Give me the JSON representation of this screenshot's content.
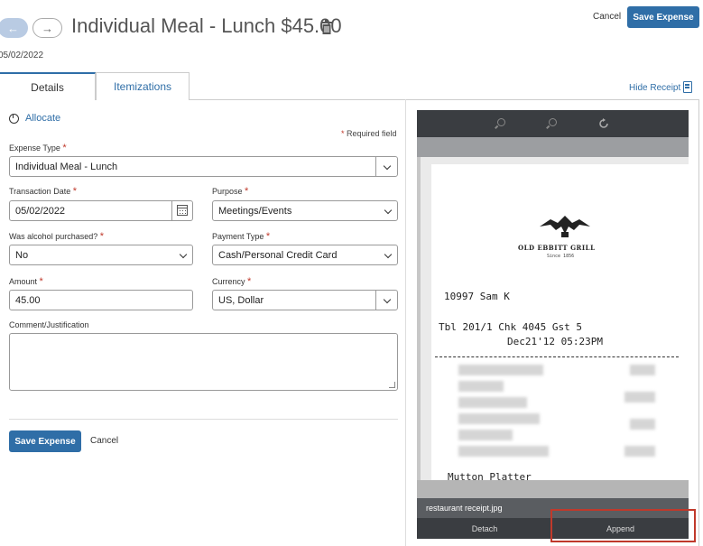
{
  "header": {
    "back_icon": "←",
    "forward_icon": "→",
    "title": "Individual Meal - Lunch $45.00",
    "date": "05/02/2022",
    "cancel_label": "Cancel",
    "save_label": "Save Expense"
  },
  "tabs": [
    {
      "label": "Details",
      "active": true
    },
    {
      "label": "Itemizations",
      "active": false
    }
  ],
  "hide_receipt_label": "Hide Receipt",
  "form": {
    "allocate_label": "Allocate",
    "required_star": "*",
    "required_text": "Required field",
    "expense_type": {
      "label": "Expense Type",
      "value": "Individual Meal - Lunch"
    },
    "transaction_date": {
      "label": "Transaction Date",
      "value": "05/02/2022"
    },
    "purpose": {
      "label": "Purpose",
      "value": "Meetings/Events"
    },
    "alcohol": {
      "label": "Was alcohol purchased?",
      "value": "No"
    },
    "payment_type": {
      "label": "Payment Type",
      "value": "Cash/Personal Credit Card"
    },
    "amount": {
      "label": "Amount",
      "value": "45.00"
    },
    "currency": {
      "label": "Currency",
      "value": "US, Dollar"
    },
    "comment": {
      "label": "Comment/Justification",
      "value": ""
    },
    "save_label": "Save Expense",
    "cancel_label": "Cancel"
  },
  "receipt": {
    "logo_text": "OLD EBBITT GRILL",
    "logo_sub": "Since 1856",
    "server_line": "10997 Sam K",
    "table_line": "Tbl 201/1      Chk 4045      Gst  5",
    "date_line": "Dec21'12 05:23PM",
    "footer_line": "Mutton Platter",
    "filename": "restaurant receipt.jpg",
    "detach_label": "Detach",
    "append_label": "Append"
  },
  "colors": {
    "accent": "#2f6ea7",
    "required": "#c0392b",
    "highlight_box": "#c0392b"
  }
}
